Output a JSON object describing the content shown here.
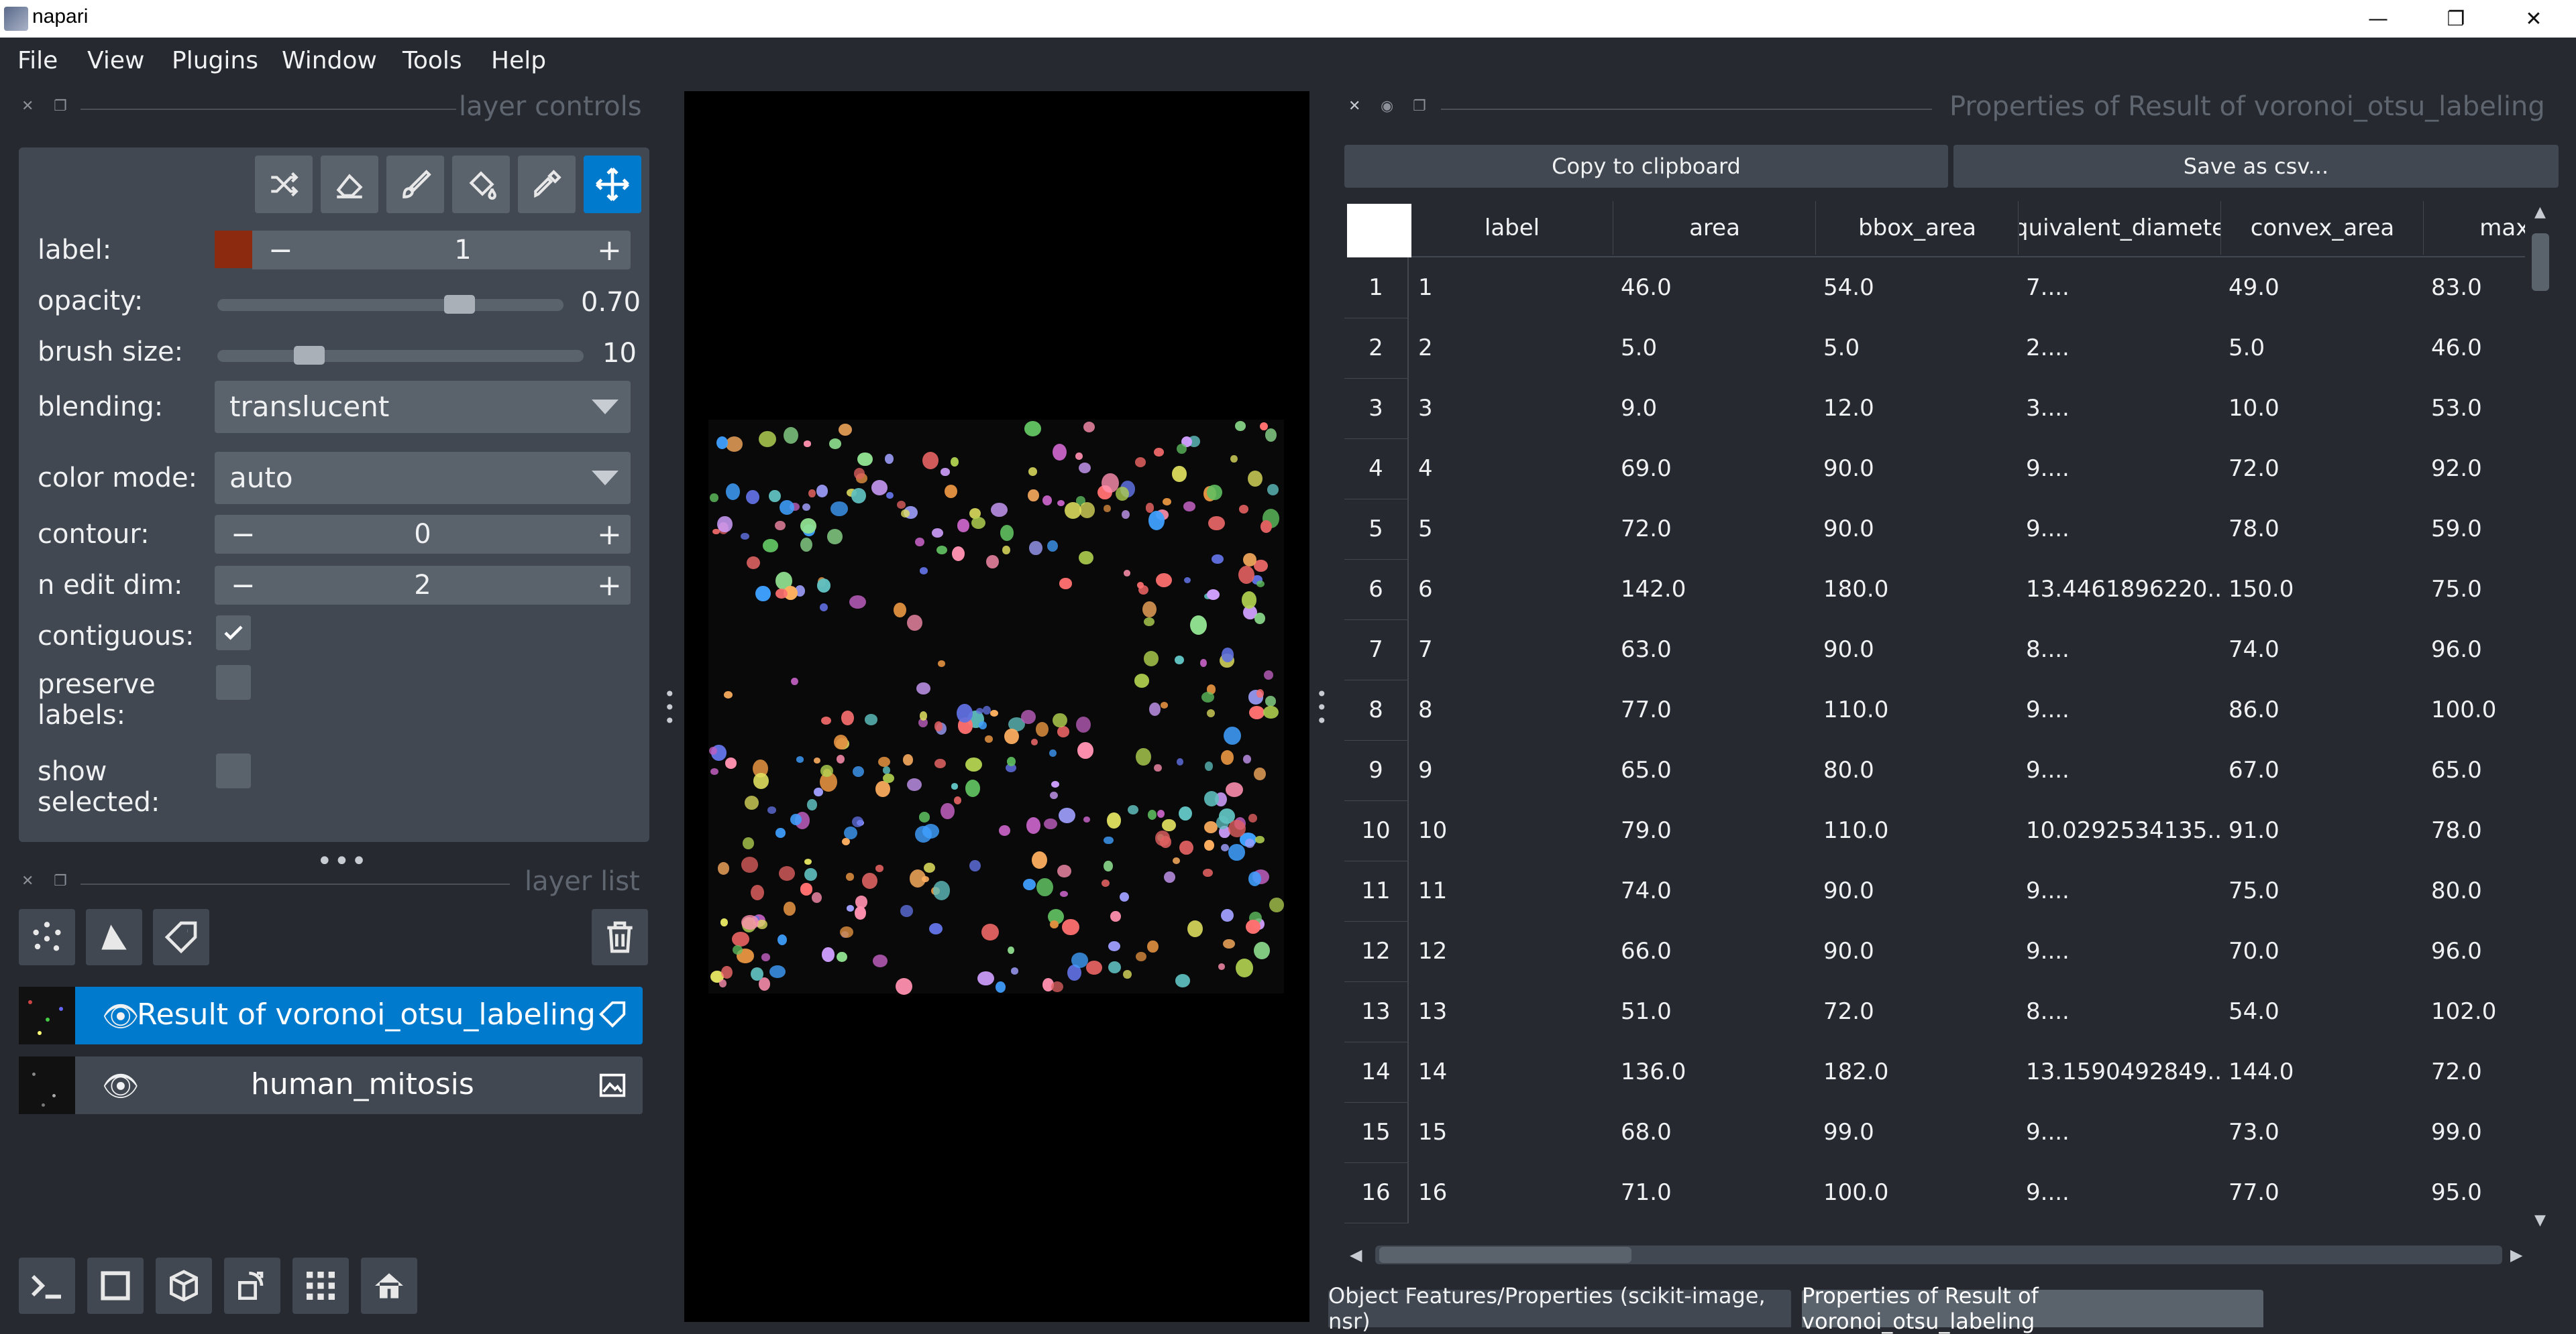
{
  "window": {
    "title": "napari",
    "minimize": "—",
    "maximize": "❐",
    "close": "✕"
  },
  "menu": [
    "File",
    "View",
    "Plugins",
    "Window",
    "Tools",
    "Help"
  ],
  "layer_controls": {
    "title": "layer controls",
    "label": {
      "label": "label:",
      "value": "1",
      "color": "#8b2a0e"
    },
    "opacity": {
      "label": "opacity:",
      "value": "0.70",
      "fraction": 0.7
    },
    "brush_size": {
      "label": "brush size:",
      "value": "10",
      "fraction": 0.25
    },
    "blending": {
      "label": "blending:",
      "value": "translucent"
    },
    "color_mode": {
      "label": "color mode:",
      "value": "auto"
    },
    "contour": {
      "label": "contour:",
      "value": "0"
    },
    "n_edit_dim": {
      "label": "n edit dim:",
      "value": "2"
    },
    "contiguous": {
      "label": "contiguous:",
      "checked": true
    },
    "preserve_labels": {
      "label_line1": "preserve",
      "label_line2": "labels:",
      "checked": false
    },
    "show_selected": {
      "label_line1": "show",
      "label_line2": "selected:",
      "checked": false
    }
  },
  "layer_list": {
    "title": "layer list",
    "layers": [
      {
        "name": "Result of voronoi_otsu_labeling",
        "selected": true,
        "type_icon": "label-tag-icon"
      },
      {
        "name": "human_mitosis",
        "selected": false,
        "type_icon": "image-icon"
      }
    ]
  },
  "properties": {
    "title": "Properties of Result of voronoi_otsu_labeling",
    "copy_label": "Copy to clipboard",
    "save_label": "Save as csv...",
    "columns": [
      "label",
      "area",
      "bbox_area",
      "quivalent_diamete",
      "convex_area",
      "max_int"
    ],
    "rows": [
      [
        "1",
        "46.0",
        "54.0",
        "7....",
        "49.0",
        "83.0"
      ],
      [
        "2",
        "5.0",
        "5.0",
        "2....",
        "5.0",
        "46.0"
      ],
      [
        "3",
        "9.0",
        "12.0",
        "3....",
        "10.0",
        "53.0"
      ],
      [
        "4",
        "69.0",
        "90.0",
        "9....",
        "72.0",
        "92.0"
      ],
      [
        "5",
        "72.0",
        "90.0",
        "9....",
        "78.0",
        "59.0"
      ],
      [
        "6",
        "142.0",
        "180.0",
        "13.4461896220...",
        "150.0",
        "75.0"
      ],
      [
        "7",
        "63.0",
        "90.0",
        "8....",
        "74.0",
        "96.0"
      ],
      [
        "8",
        "77.0",
        "110.0",
        "9....",
        "86.0",
        "100.0"
      ],
      [
        "9",
        "65.0",
        "80.0",
        "9....",
        "67.0",
        "65.0"
      ],
      [
        "10",
        "79.0",
        "110.0",
        "10.0292534135...",
        "91.0",
        "78.0"
      ],
      [
        "11",
        "74.0",
        "90.0",
        "9....",
        "75.0",
        "80.0"
      ],
      [
        "12",
        "66.0",
        "90.0",
        "9....",
        "70.0",
        "96.0"
      ],
      [
        "13",
        "51.0",
        "72.0",
        "8....",
        "54.0",
        "102.0"
      ],
      [
        "14",
        "136.0",
        "182.0",
        "13.1590492849...",
        "144.0",
        "72.0"
      ],
      [
        "15",
        "68.0",
        "99.0",
        "9....",
        "73.0",
        "99.0"
      ],
      [
        "16",
        "71.0",
        "100.0",
        "9....",
        "77.0",
        "95.0"
      ]
    ],
    "row_numbers": [
      "1",
      "2",
      "3",
      "4",
      "5",
      "6",
      "7",
      "8",
      "9",
      "10",
      "11",
      "12",
      "13",
      "14",
      "15",
      "16"
    ]
  },
  "tabs": [
    {
      "label": "Object Features/Properties (scikit-image, nsr)",
      "active": false
    },
    {
      "label": "Properties of Result of voronoi_otsu_labeling",
      "active": true
    }
  ],
  "colors": {
    "accent": "#007acc",
    "panel": "#414851",
    "background": "#262930"
  }
}
